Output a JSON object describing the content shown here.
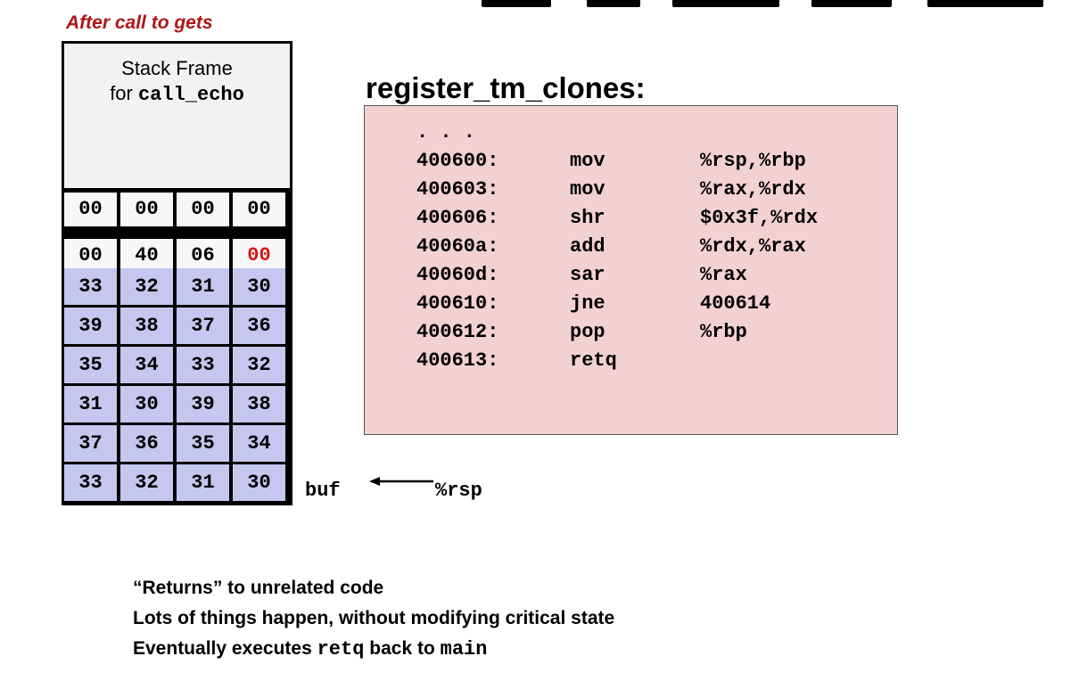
{
  "caption": "After call to gets",
  "stack_frame": {
    "line1": "Stack Frame",
    "line2_prefix": "for ",
    "line2_code": "call_echo"
  },
  "stack_rows": [
    {
      "cells": [
        "00",
        "00",
        "00",
        "00"
      ],
      "style": "white"
    },
    {
      "cells": [
        "00",
        "40",
        "06",
        "00"
      ],
      "style": "white",
      "highlight_index": 3
    },
    {
      "cells": [
        "33",
        "32",
        "31",
        "30"
      ],
      "style": "purple"
    },
    {
      "cells": [
        "39",
        "38",
        "37",
        "36"
      ],
      "style": "purple"
    },
    {
      "cells": [
        "35",
        "34",
        "33",
        "32"
      ],
      "style": "purple"
    },
    {
      "cells": [
        "31",
        "30",
        "39",
        "38"
      ],
      "style": "purple"
    },
    {
      "cells": [
        "37",
        "36",
        "35",
        "34"
      ],
      "style": "purple"
    },
    {
      "cells": [
        "33",
        "32",
        "31",
        "30"
      ],
      "style": "purple"
    }
  ],
  "buf_label": "buf",
  "rsp_label": "%rsp",
  "function_title": "register_tm_clones:",
  "asm": {
    "ellipsis": ". . .",
    "lines": [
      {
        "addr": "400600:",
        "op": "mov",
        "args": "%rsp,%rbp"
      },
      {
        "addr": "400603:",
        "op": "mov",
        "args": "%rax,%rdx"
      },
      {
        "addr": "400606:",
        "op": "shr",
        "args": "$0x3f,%rdx"
      },
      {
        "addr": "40060a:",
        "op": "add",
        "args": "%rdx,%rax"
      },
      {
        "addr": "40060d:",
        "op": "sar",
        "args": "%rax"
      },
      {
        "addr": "400610:",
        "op": "jne",
        "args": "400614"
      },
      {
        "addr": "400612:",
        "op": "pop",
        "args": "%rbp"
      },
      {
        "addr": "400613:",
        "op": "retq",
        "args": ""
      }
    ]
  },
  "bullets": {
    "line1": "“Returns” to unrelated code",
    "line2": "Lots of things happen, without modifying critical state",
    "line3_a": "Eventually executes ",
    "line3_code1": "retq",
    "line3_b": " back to ",
    "line3_code2": "main"
  },
  "colors": {
    "caption": "#b01515",
    "highlight": "#d61515",
    "purple_cell": "#c6c7ef",
    "asm_bg": "#f3d1d1"
  }
}
